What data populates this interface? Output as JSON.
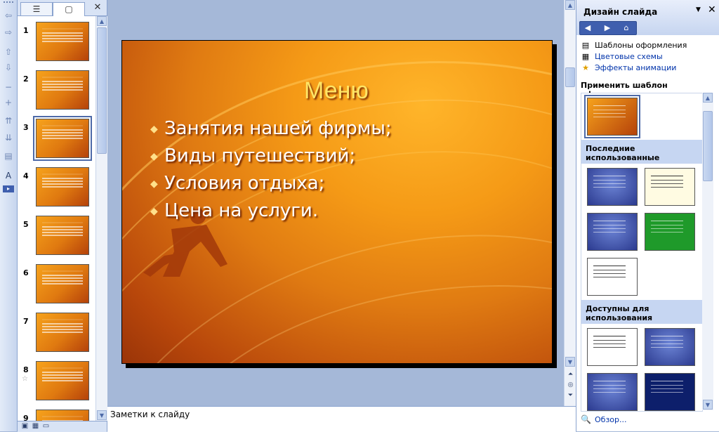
{
  "thumbnails": {
    "numbers": [
      "1",
      "2",
      "3",
      "4",
      "5",
      "6",
      "7",
      "8",
      "9"
    ],
    "selected": "3"
  },
  "slide": {
    "title": "Меню",
    "bullets": [
      "Занятия нашей фирмы;",
      "Виды путешествий;",
      "Условия отдыха;",
      "Цена на услуги."
    ]
  },
  "notes": {
    "placeholder": "Заметки к слайду"
  },
  "task_pane": {
    "title": "Дизайн слайда",
    "links": [
      "Шаблоны оформления",
      "Цветовые схемы",
      "Эффекты анимации"
    ],
    "section_label": "Применить шаблон оформления:",
    "groups": [
      "Последние использованные",
      "Доступны для использования"
    ],
    "browse": "Обзор..."
  },
  "colors": {
    "accent": "#4d6aa8",
    "slide_orange": "#e07b12",
    "title_yellow": "#ffe566"
  }
}
